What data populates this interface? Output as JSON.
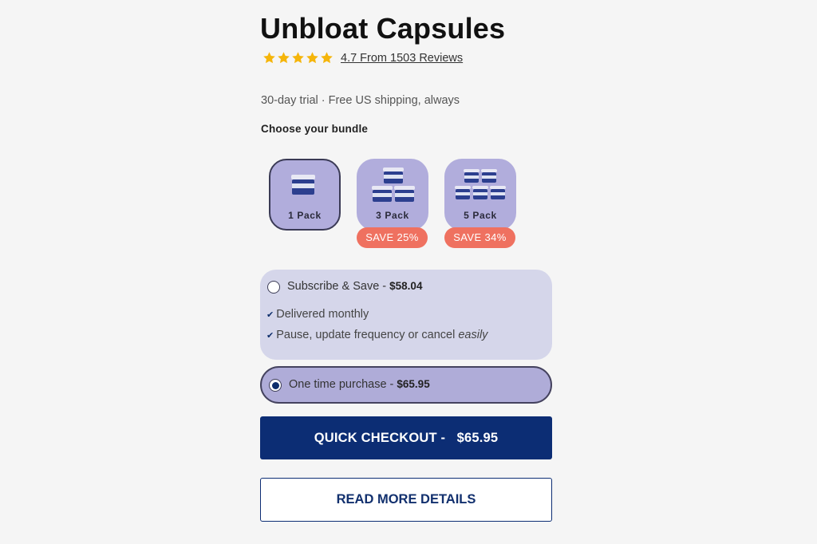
{
  "product": {
    "title": "Unbloat Capsules",
    "rating_stars": 5,
    "rating_value": 4.7,
    "reviews_link": "4.7 From 1503 Reviews",
    "trial_text": "30-day trial · Free US shipping, always"
  },
  "bundle": {
    "heading": "Choose your bundle",
    "selected": "1 Pack",
    "packs": [
      {
        "label": "1 Pack",
        "badge": ""
      },
      {
        "label": "3 Pack",
        "badge": "SAVE 25%"
      },
      {
        "label": "5 Pack",
        "badge": "SAVE 34%"
      }
    ]
  },
  "purchase": {
    "subscribe": {
      "label": "Subscribe & Save - ",
      "price": "$58.04",
      "benefits": [
        "Delivered monthly",
        "Pause, update frequency or cancel",
        "easily"
      ],
      "selected": false
    },
    "one_time": {
      "label": "One time purchase - ",
      "price": "$65.95",
      "selected": true
    }
  },
  "actions": {
    "checkout_label": "QUICK CHECKOUT -",
    "checkout_price": "$65.95",
    "details_label": "READ MORE DETAILS"
  },
  "colors": {
    "accent": "#0c2d74",
    "pack_bg": "#b1addc",
    "badge": "#ef7160",
    "star": "#f5b50a",
    "subscribe_bg": "#d5d6ea",
    "one_time_bg": "#afacd8"
  },
  "icons": {
    "rating": "star-icon",
    "check": "checkmark-icon",
    "product": "capsule-jar-icon"
  }
}
